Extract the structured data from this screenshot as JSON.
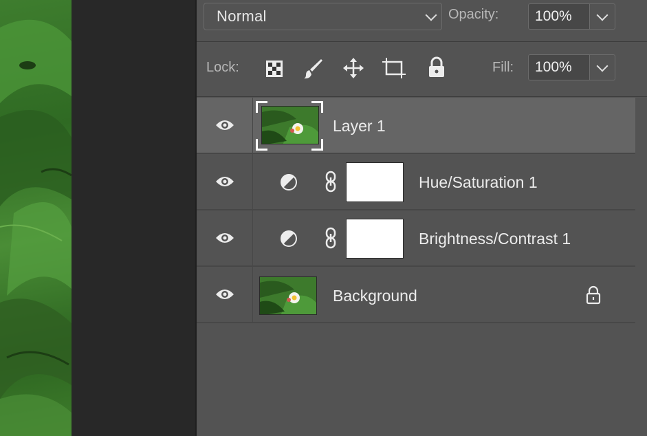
{
  "blend_mode": {
    "value": "Normal"
  },
  "opacity": {
    "label": "Opacity:",
    "value": "100%"
  },
  "lock": {
    "label": "Lock:"
  },
  "fill": {
    "label": "Fill:",
    "value": "100%"
  },
  "layers": [
    {
      "name": "Layer 1",
      "selected": true,
      "type": "pixel",
      "icon": "eye-icon"
    },
    {
      "name": "Hue/Saturation 1",
      "type": "adjustment",
      "icon": "eye-icon"
    },
    {
      "name": "Brightness/Contrast 1",
      "type": "adjustment",
      "icon": "eye-icon"
    },
    {
      "name": "Background",
      "type": "background",
      "locked": true,
      "icon": "eye-icon"
    }
  ],
  "colors": {
    "panel_bg": "#535353",
    "selected_row": "#656565",
    "pasteboard": "#282828"
  }
}
